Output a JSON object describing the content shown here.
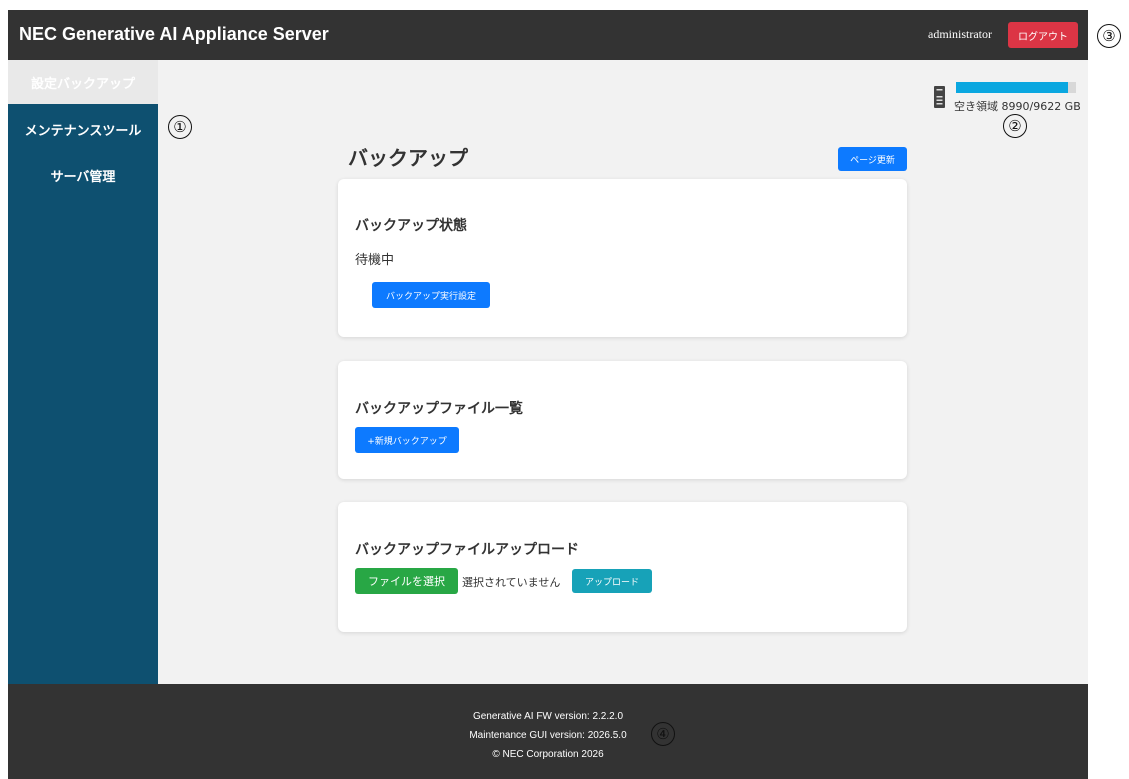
{
  "header": {
    "title": "NEC Generative AI Appliance Server",
    "username": "administrator",
    "logout_label": "ログアウト"
  },
  "sidebar": {
    "items": [
      {
        "label": "設定バックアップ",
        "active": true
      },
      {
        "label": "メンテナンスツール",
        "active": false
      },
      {
        "label": "サーバ管理",
        "active": false
      }
    ]
  },
  "storage": {
    "icon": "server-icon",
    "text": "空き領域 8990/9622 GB",
    "free_gb": 8990,
    "total_gb": 9622,
    "bar_color": "#0aa7e0"
  },
  "main": {
    "title": "バックアップ",
    "refresh_label": "ページ更新",
    "status_card": {
      "title": "バックアップ状態",
      "status": "待機中",
      "button_label": "バックアップ実行設定"
    },
    "list_card": {
      "title": "バックアップファイル一覧",
      "button_label": "+新規バックアップ"
    },
    "upload_card": {
      "title": "バックアップファイルアップロード",
      "choose_label": "ファイルを選択",
      "no_file_text": "選択されていません",
      "upload_label": "アップロード"
    }
  },
  "footer": {
    "fw_version": "Generative AI FW version: 2.2.2.0",
    "gui_version": "Maintenance GUI version: 2026.5.0",
    "copyright": "© NEC Corporation 2026"
  },
  "callouts": [
    "①",
    "②",
    "③",
    "④"
  ],
  "colors": {
    "header_bg": "#333333",
    "sidebar_bg": "#0e5070",
    "primary": "#0d7aff",
    "danger": "#dc3545",
    "success": "#28a745",
    "info": "#17a2b8"
  }
}
